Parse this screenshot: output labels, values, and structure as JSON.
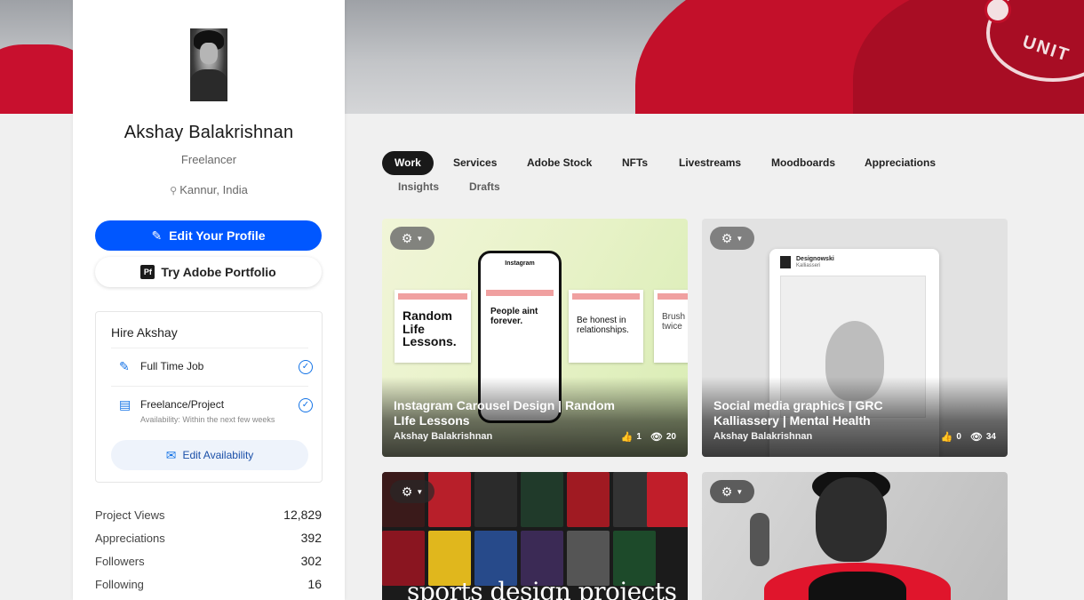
{
  "profile": {
    "name": "Akshay Balakrishnan",
    "occupation": "Freelancer",
    "location": "Kannur, India",
    "edit_profile_label": "Edit Your Profile",
    "portfolio_badge": "Pf",
    "portfolio_label": "Try Adobe Portfolio"
  },
  "hire": {
    "title": "Hire Akshay",
    "options": [
      {
        "label": "Full Time Job",
        "sub": ""
      },
      {
        "label": "Freelance/Project",
        "sub": "Availability: Within the next few weeks"
      }
    ],
    "edit_availability_label": "Edit Availability"
  },
  "stats": [
    {
      "label": "Project Views",
      "value": "12,829"
    },
    {
      "label": "Appreciations",
      "value": "392"
    },
    {
      "label": "Followers",
      "value": "302"
    },
    {
      "label": "Following",
      "value": "16"
    }
  ],
  "tabs": [
    "Work",
    "Services",
    "Adobe Stock",
    "NFTs",
    "Livestreams",
    "Moodboards",
    "Appreciations",
    "Insights",
    "Drafts"
  ],
  "projects": [
    {
      "title": "Instagram Carousel Design | Random LIfe Lessons",
      "owner": "Akshay Balakrishnan",
      "likes": "1",
      "views": "20"
    },
    {
      "title": "Social media graphics | GRC Kalliassery | Mental Health",
      "owner": "Akshay Balakrishnan",
      "likes": "0",
      "views": "34"
    },
    {
      "title": "",
      "owner": "",
      "likes": "",
      "views": ""
    },
    {
      "title": "",
      "owner": "",
      "likes": "",
      "views": ""
    }
  ],
  "thumb1": {
    "phone_app": "Instagram",
    "sq1": "Random Life Lessons.",
    "sq2": "People aint forever.",
    "sq3": "Be honest in relationships.",
    "sq4": "Brush twice"
  },
  "thumb2": {
    "account": "Designowski",
    "account_sub": "Kalliasseri"
  },
  "thumb3": {
    "text": "sports design projects"
  },
  "banner": {
    "crest_text": "UNIT"
  },
  "colors": {
    "accent": "#0057ff",
    "banner_red": "#c3102a"
  }
}
